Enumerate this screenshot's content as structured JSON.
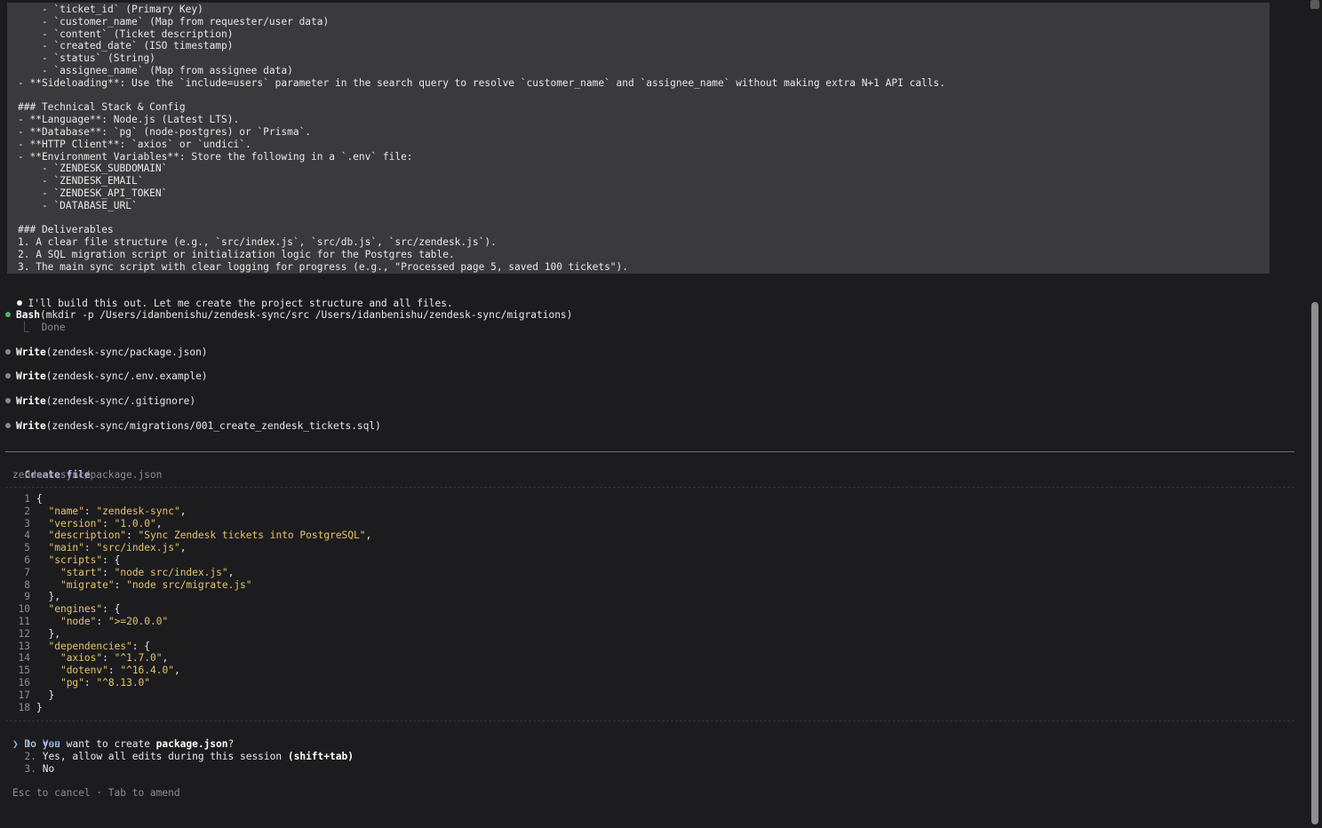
{
  "prompt_lines": [
    "    - `ticket_id` (Primary Key)",
    "    - `customer_name` (Map from requester/user data)",
    "    - `content` (Ticket description)",
    "    - `created_date` (ISO timestamp)",
    "    - `status` (String)",
    "    - `assignee_name` (Map from assignee data)",
    "- **Sideloading**: Use the `include=users` parameter in the search query to resolve `customer_name` and `assignee_name` without making extra N+1 API calls.",
    "",
    "### Technical Stack & Config",
    "- **Language**: Node.js (Latest LTS).",
    "- **Database**: `pg` (node-postgres) or `Prisma`.",
    "- **HTTP Client**: `axios` or `undici`.",
    "- **Environment Variables**: Store the following in a `.env` file:",
    "    - `ZENDESK_SUBDOMAIN`",
    "    - `ZENDESK_EMAIL`",
    "    - `ZENDESK_API_TOKEN`",
    "    - `DATABASE_URL`",
    "",
    "### Deliverables",
    "1. A clear file structure (e.g., `src/index.js`, `src/db.js`, `src/zendesk.js`).",
    "2. A SQL migration script or initialization logic for the Postgres table.",
    "3. The main sync script with clear logging for progress (e.g., \"Processed page 5, saved 100 tickets\")."
  ],
  "assistant_message": "I'll build this out. Let me create the project structure and all files.",
  "tool_calls": [
    {
      "tool": "Bash",
      "args": "(mkdir -p /Users/idanbenishu/zendesk-sync/src /Users/idanbenishu/zendesk-sync/migrations)",
      "result": "Done",
      "status": "green"
    },
    {
      "tool": "Write",
      "args": "(zendesk-sync/package.json)",
      "status": "gray"
    },
    {
      "tool": "Write",
      "args": "(zendesk-sync/.env.example)",
      "status": "gray"
    },
    {
      "tool": "Write",
      "args": "(zendesk-sync/.gitignore)",
      "status": "gray"
    },
    {
      "tool": "Write",
      "args": "(zendesk-sync/migrations/001_create_zendesk_tickets.sql)",
      "status": "gray"
    }
  ],
  "result_prefix": "⎿  ",
  "create_file": {
    "title": "Create file",
    "path": "zendesk-sync/package.json"
  },
  "code_lines": [
    {
      "n": "1",
      "text": "{"
    },
    {
      "n": "2",
      "text": "  \"name\": \"zendesk-sync\","
    },
    {
      "n": "3",
      "text": "  \"version\": \"1.0.0\","
    },
    {
      "n": "4",
      "text": "  \"description\": \"Sync Zendesk tickets into PostgreSQL\","
    },
    {
      "n": "5",
      "text": "  \"main\": \"src/index.js\","
    },
    {
      "n": "6",
      "text": "  \"scripts\": {"
    },
    {
      "n": "7",
      "text": "    \"start\": \"node src/index.js\","
    },
    {
      "n": "8",
      "text": "    \"migrate\": \"node src/migrate.js\""
    },
    {
      "n": "9",
      "text": "  },"
    },
    {
      "n": "10",
      "text": "  \"engines\": {"
    },
    {
      "n": "11",
      "text": "    \"node\": \">=20.0.0\""
    },
    {
      "n": "12",
      "text": "  },"
    },
    {
      "n": "13",
      "text": "  \"dependencies\": {"
    },
    {
      "n": "14",
      "text": "    \"axios\": \"^1.7.0\","
    },
    {
      "n": "15",
      "text": "    \"dotenv\": \"^16.4.0\","
    },
    {
      "n": "16",
      "text": "    \"pg\": \"^8.13.0\""
    },
    {
      "n": "17",
      "text": "  }"
    },
    {
      "n": "18",
      "text": "}"
    }
  ],
  "question": {
    "prefix": "Do you want to create ",
    "file": "package.json",
    "suffix": "?"
  },
  "choices": [
    {
      "marker": "❯",
      "num": "1.",
      "label": "Yes",
      "hint": ""
    },
    {
      "marker": " ",
      "num": "2.",
      "label": "Yes, allow all edits during this session ",
      "hint": "(shift+tab)"
    },
    {
      "marker": " ",
      "num": "3.",
      "label": "No",
      "hint": ""
    }
  ],
  "footer_hint": "Esc to cancel · Tab to amend",
  "colors": {
    "background": "#1c1c1e",
    "prompt_block": "#3a3a3c",
    "accent_purple": "#b9b3ff",
    "json_key": "#e6c46a",
    "success_dot": "#4fb56b",
    "selected_choice": "#7fb0ff"
  }
}
